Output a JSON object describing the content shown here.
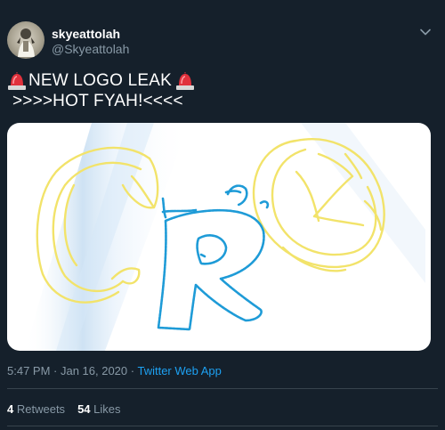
{
  "user": {
    "display_name": "skyeattolah",
    "handle": "@Skyeattolah",
    "avatar_icon": "avatar-photo"
  },
  "tweet": {
    "line1_text": "NEW LOGO LEAK",
    "line2_text": ">>>>HOT FYAH!<<<<",
    "emoji_icon": "police-car-light-icon"
  },
  "meta": {
    "time_date": "5:47 PM · Jan 16, 2020 · ",
    "app": "Twitter Web App"
  },
  "stats": {
    "retweets_count": "4",
    "retweets_label": "Retweets",
    "likes_count": "54",
    "likes_label": "Likes"
  },
  "colors": {
    "background": "#15202b",
    "accent": "#1da1f2",
    "muted": "#8899a6",
    "divider": "#38444d",
    "doodle_yellow": "#f2e36a",
    "doodle_blue": "#1e9bd7"
  }
}
